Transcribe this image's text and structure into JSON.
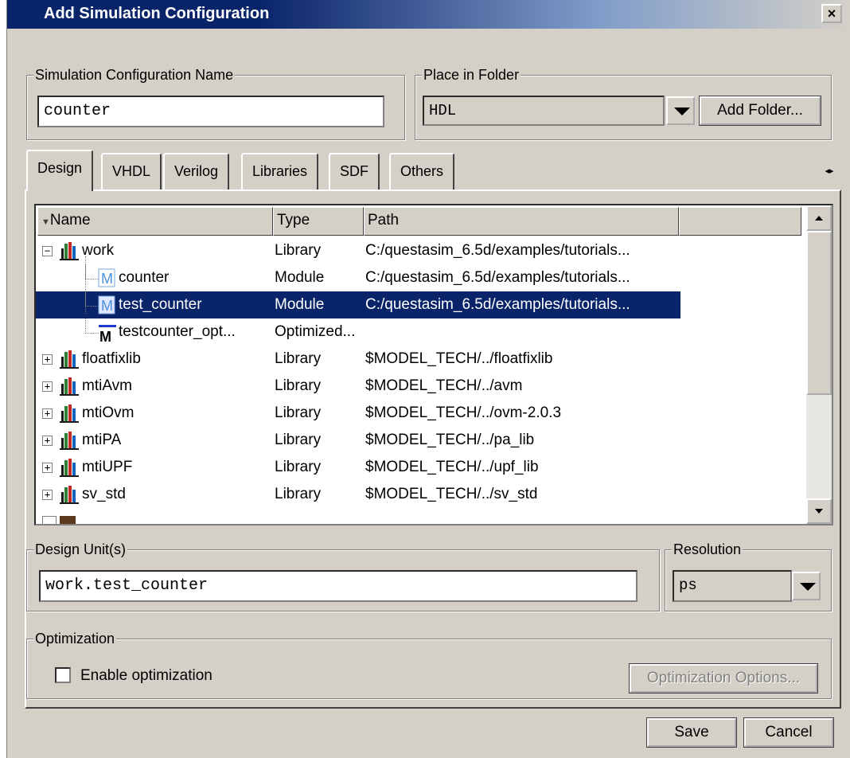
{
  "window": {
    "title": "Add Simulation Configuration",
    "close_glyph": "×"
  },
  "config_name": {
    "legend": "Simulation Configuration Name",
    "value": "counter"
  },
  "folder": {
    "legend": "Place in Folder",
    "value": "HDL",
    "add_button": "Add Folder..."
  },
  "tabs": [
    {
      "label": "Design",
      "active": true
    },
    {
      "label": "VHDL",
      "active": false
    },
    {
      "label": "Verilog",
      "active": false
    },
    {
      "label": "Libraries",
      "active": false
    },
    {
      "label": "SDF",
      "active": false
    },
    {
      "label": "Others",
      "active": false
    }
  ],
  "tab_scroll_glyph": "◂▸",
  "table": {
    "columns": [
      "Name",
      "Type",
      "Path"
    ],
    "rows": [
      {
        "name": "work",
        "type": "Library",
        "path": "C:/questasim_6.5d/examples/tutorials...",
        "icon": "library-icon",
        "level": 0,
        "expander": "−",
        "selected": false
      },
      {
        "name": "counter",
        "type": "Module",
        "path": "C:/questasim_6.5d/examples/tutorials...",
        "icon": "module-icon",
        "level": 1,
        "expander": "",
        "selected": false
      },
      {
        "name": "test_counter",
        "type": "Module",
        "path": "C:/questasim_6.5d/examples/tutorials...",
        "icon": "module-icon",
        "level": 1,
        "expander": "",
        "selected": true
      },
      {
        "name": "testcounter_opt...",
        "type": "Optimized...",
        "path": "",
        "icon": "optimized-icon",
        "level": 1,
        "expander": "",
        "selected": false
      },
      {
        "name": "floatfixlib",
        "type": "Library",
        "path": "$MODEL_TECH/../floatfixlib",
        "icon": "library-icon",
        "level": 0,
        "expander": "+",
        "selected": false
      },
      {
        "name": "mtiAvm",
        "type": "Library",
        "path": "$MODEL_TECH/../avm",
        "icon": "library-icon",
        "level": 0,
        "expander": "+",
        "selected": false
      },
      {
        "name": "mtiOvm",
        "type": "Library",
        "path": "$MODEL_TECH/../ovm-2.0.3",
        "icon": "library-icon",
        "level": 0,
        "expander": "+",
        "selected": false
      },
      {
        "name": "mtiPA",
        "type": "Library",
        "path": "$MODEL_TECH/../pa_lib",
        "icon": "library-icon",
        "level": 0,
        "expander": "+",
        "selected": false
      },
      {
        "name": "mtiUPF",
        "type": "Library",
        "path": "$MODEL_TECH/../upf_lib",
        "icon": "library-icon",
        "level": 0,
        "expander": "+",
        "selected": false
      },
      {
        "name": "sv_std",
        "type": "Library",
        "path": "$MODEL_TECH/../sv_std",
        "icon": "library-icon",
        "level": 0,
        "expander": "+",
        "selected": false
      }
    ]
  },
  "design_units": {
    "legend": "Design Unit(s)",
    "value": "work.test_counter"
  },
  "resolution": {
    "legend": "Resolution",
    "value": "ps"
  },
  "optimization": {
    "legend": "Optimization",
    "checkbox_label": "Enable optimization",
    "checked": false,
    "options_button": "Optimization Options..."
  },
  "footer": {
    "save": "Save",
    "cancel": "Cancel"
  },
  "colors": {
    "title_active": "#0a246a",
    "selection": "#0a246a",
    "face": "#d4d0c8"
  }
}
